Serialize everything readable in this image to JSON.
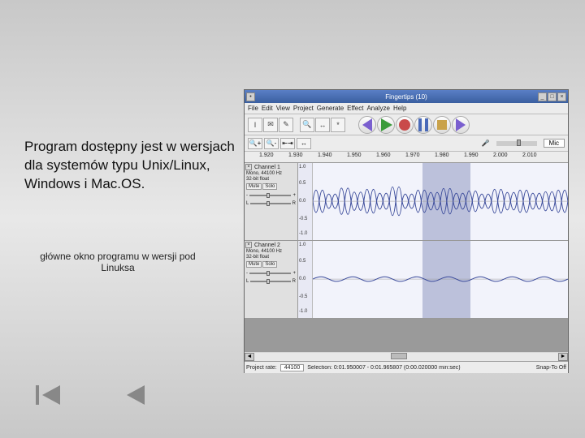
{
  "description": "Program dostępny jest w wersjach dla systemów typu Unix/Linux, Windows i Mac.OS.",
  "caption": "główne okno programu w wersji pod Linuksa",
  "window": {
    "title": "Fingertips (10)"
  },
  "menu": [
    "File",
    "Edit",
    "View",
    "Project",
    "Generate",
    "Effect",
    "Analyze",
    "Help"
  ],
  "ruler": {
    "ticks": [
      "1.920",
      "1.930",
      "1.940",
      "1.950",
      "1.960",
      "1.970",
      "1.980",
      "1.990",
      "2.000",
      "2.010"
    ]
  },
  "tracks": [
    {
      "name": "Channel 1",
      "info1": "Mono, 44100 Hz",
      "info2": "32-bit float",
      "mute": "Mute",
      "solo": "Solo",
      "scale": [
        "1.0",
        "0.5",
        "0.0",
        "-0.5",
        "-1.0"
      ]
    },
    {
      "name": "Channel 2",
      "info1": "Mono, 44100 Hz",
      "info2": "32-bit float",
      "mute": "Mute",
      "solo": "Solo",
      "scale": [
        "1.0",
        "0.5",
        "0.0",
        "-0.5",
        "-1.0"
      ]
    }
  ],
  "toolbar2": {
    "mic_label": "Mic",
    "vol": "0.5"
  },
  "status": {
    "rate_label": "Project rate:",
    "rate": "44100",
    "selection": "Selection: 0:01.950007 - 0:01.965807 (0:00.020000 min:sec)",
    "snap": "Snap-To Off"
  }
}
